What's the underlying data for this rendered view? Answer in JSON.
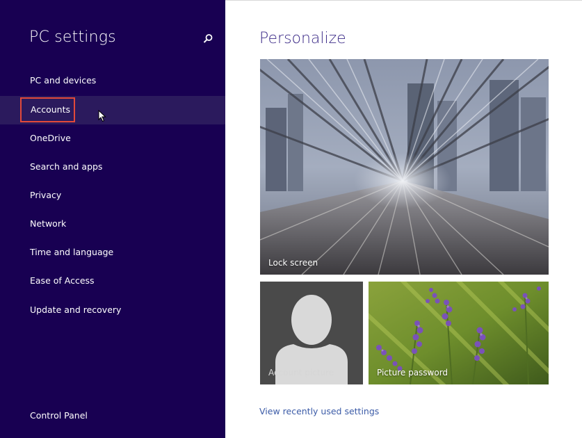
{
  "sidebar": {
    "title": "PC settings",
    "items": [
      {
        "label": "PC and devices"
      },
      {
        "label": "Accounts",
        "selected": true
      },
      {
        "label": "OneDrive"
      },
      {
        "label": "Search and apps"
      },
      {
        "label": "Privacy"
      },
      {
        "label": "Network"
      },
      {
        "label": "Time and language"
      },
      {
        "label": "Ease of Access"
      },
      {
        "label": "Update and recovery"
      }
    ],
    "footer_link": "Control Panel"
  },
  "main": {
    "title": "Personalize",
    "tiles": {
      "lock_screen": "Lock screen",
      "account_picture": "Account picture",
      "picture_password": "Picture password"
    },
    "recent_link": "View recently used settings"
  },
  "colors": {
    "sidebar_bg": "#180052",
    "selected_bg": "#2b1a5d",
    "selection_outline": "#e24a3a",
    "title_color": "#3b2a87",
    "link_color": "#3b5ba7"
  },
  "icons": [
    "search-icon",
    "mouse-cursor-icon",
    "user-silhouette-icon"
  ]
}
